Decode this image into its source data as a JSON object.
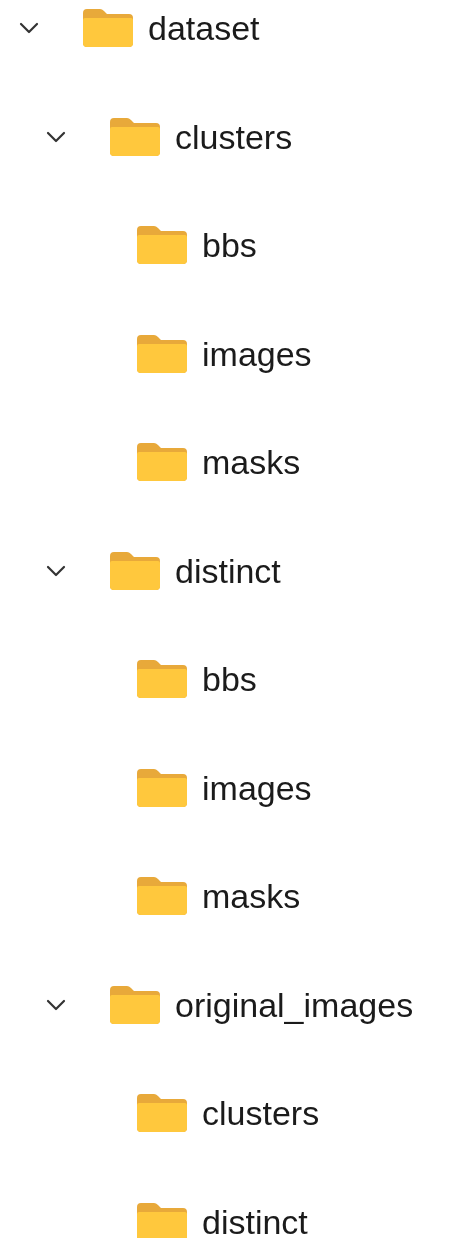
{
  "tree": [
    {
      "label": "dataset",
      "expanded": true,
      "children": [
        {
          "label": "clusters",
          "expanded": true,
          "children": [
            {
              "label": "bbs"
            },
            {
              "label": "images"
            },
            {
              "label": "masks"
            }
          ]
        },
        {
          "label": "distinct",
          "expanded": true,
          "children": [
            {
              "label": "bbs"
            },
            {
              "label": "images"
            },
            {
              "label": "masks"
            }
          ]
        },
        {
          "label": "original_images",
          "expanded": true,
          "children": [
            {
              "label": "clusters"
            },
            {
              "label": "distinct"
            }
          ]
        }
      ]
    }
  ]
}
